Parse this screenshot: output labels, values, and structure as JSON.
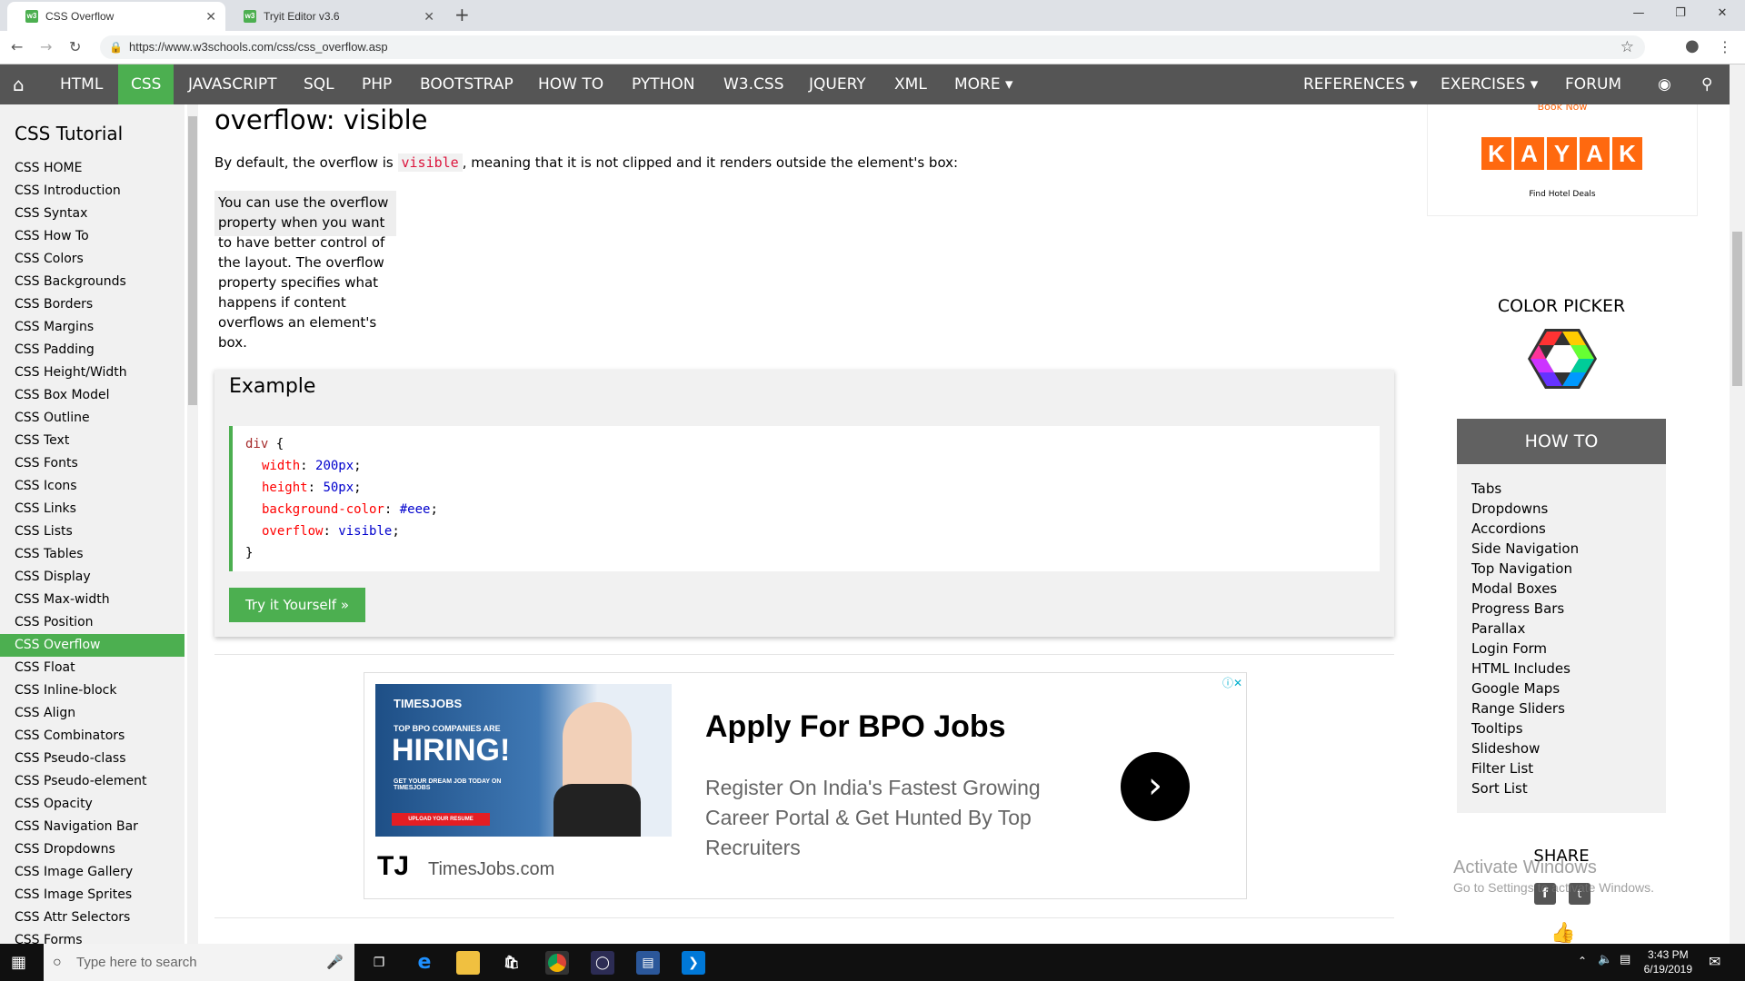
{
  "browser": {
    "tabs": [
      {
        "title": "CSS Overflow",
        "active": true
      },
      {
        "title": "Tryit Editor v3.6",
        "active": false
      }
    ],
    "new_tab": "+",
    "url": "https://www.w3schools.com/css/css_overflow.asp"
  },
  "topnav": {
    "items": [
      "HTML",
      "CSS",
      "JAVASCRIPT",
      "SQL",
      "PHP",
      "BOOTSTRAP",
      "HOW TO",
      "PYTHON",
      "W3.CSS",
      "JQUERY",
      "XML",
      "MORE ▾"
    ],
    "active": "CSS",
    "right_items": [
      "REFERENCES ▾",
      "EXERCISES ▾",
      "FORUM"
    ]
  },
  "sidebar": {
    "title": "CSS Tutorial",
    "items": [
      "CSS HOME",
      "CSS Introduction",
      "CSS Syntax",
      "CSS How To",
      "CSS Colors",
      "CSS Backgrounds",
      "CSS Borders",
      "CSS Margins",
      "CSS Padding",
      "CSS Height/Width",
      "CSS Box Model",
      "CSS Outline",
      "CSS Text",
      "CSS Fonts",
      "CSS Icons",
      "CSS Links",
      "CSS Lists",
      "CSS Tables",
      "CSS Display",
      "CSS Max-width",
      "CSS Position",
      "CSS Overflow",
      "CSS Float",
      "CSS Inline-block",
      "CSS Align",
      "CSS Combinators",
      "CSS Pseudo-class",
      "CSS Pseudo-element",
      "CSS Opacity",
      "CSS Navigation Bar",
      "CSS Dropdowns",
      "CSS Image Gallery",
      "CSS Image Sprites",
      "CSS Attr Selectors",
      "CSS Forms"
    ],
    "active": "CSS Overflow"
  },
  "main": {
    "title": "overflow: visible",
    "intro_before": "By default, the overflow is ",
    "intro_code": "visible",
    "intro_after": ", meaning that it is not clipped and it renders outside the element's box:",
    "demo_text": "You can use the overflow property when you want to have better control of the layout. The overflow property specifies what happens if content overflows an element's box.",
    "example": {
      "heading": "Example",
      "selector": "div",
      "open": " {",
      "close": "}",
      "declarations": [
        {
          "prop": "width",
          "val": "200px"
        },
        {
          "prop": "height",
          "val": "50px"
        },
        {
          "prop": "background-color",
          "val": "#eee"
        },
        {
          "prop": "overflow",
          "val": "visible"
        }
      ],
      "button": "Try it Yourself »"
    }
  },
  "ad": {
    "img_brand": "TIMESJOBS",
    "img_line1": "TOP BPO COMPANIES ARE",
    "img_line2": "HIRING!",
    "img_line3": "GET YOUR DREAM JOB TODAY ON TIMESJOBS",
    "img_button": "UPLOAD YOUR RESUME",
    "title": "Apply For BPO Jobs",
    "desc": "Register On India's Fastest Growing Career Portal & Get Hunted By Top Recruiters",
    "logo": "TJ",
    "brand": "TimesJobs.com"
  },
  "right": {
    "book_now": "Book Now",
    "kayak": [
      "K",
      "A",
      "Y",
      "A",
      "K"
    ],
    "kayak_caption": "Find Hotel Deals",
    "color_picker": "COLOR PICKER",
    "howto_title": "HOW TO",
    "howto_items": [
      "Tabs",
      "Dropdowns",
      "Accordions",
      "Side Navigation",
      "Top Navigation",
      "Modal Boxes",
      "Progress Bars",
      "Parallax",
      "Login Form",
      "HTML Includes",
      "Google Maps",
      "Range Sliders",
      "Tooltips",
      "Slideshow",
      "Filter List",
      "Sort List"
    ],
    "share": "SHARE"
  },
  "watermark": {
    "line1": "Activate Windows",
    "line2": "Go to Settings to activate Windows."
  },
  "taskbar": {
    "search_placeholder": "Type here to search",
    "time": "3:43 PM",
    "date": "6/19/2019"
  },
  "colors": {
    "accent": "#4CAF50",
    "nav": "#555555",
    "kayak": "#ff690f"
  }
}
